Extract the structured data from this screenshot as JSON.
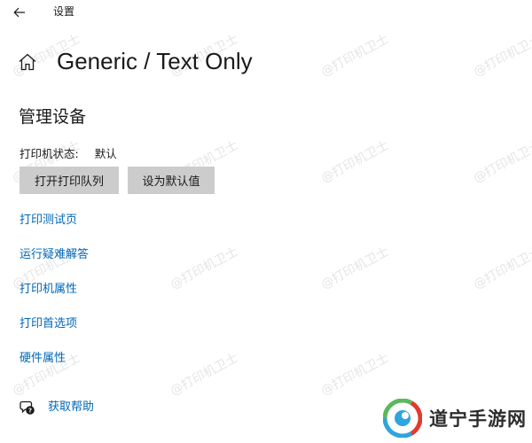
{
  "window": {
    "title": "设置",
    "back_icon": "arrow-left-icon"
  },
  "header": {
    "home_icon": "home-icon",
    "title": "Generic / Text Only"
  },
  "manage": {
    "section_title": "管理设备",
    "status_label": "打印机状态:",
    "status_value": "默认",
    "buttons": {
      "open_queue": "打开打印队列",
      "set_default": "设为默认值"
    }
  },
  "links": [
    {
      "label": "打印测试页"
    },
    {
      "label": "运行疑难解答"
    },
    {
      "label": "打印机属性"
    },
    {
      "label": "打印首选项"
    },
    {
      "label": "硬件属性"
    }
  ],
  "help": {
    "icon": "help-chat-icon",
    "label": "获取帮助"
  },
  "watermark": {
    "text": "@打印机卫士"
  },
  "brand": {
    "name": "道宁手游网"
  },
  "colors": {
    "link": "#0067b8",
    "button_bg": "#cccccc",
    "background": "#ffffff"
  }
}
